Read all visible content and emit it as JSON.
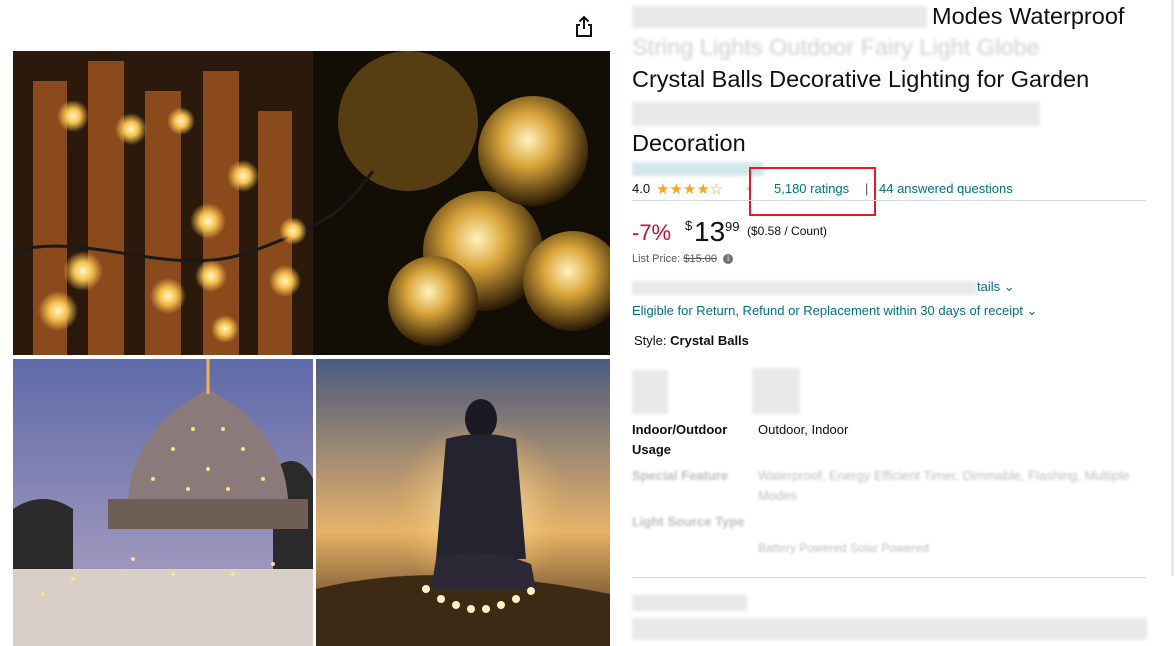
{
  "product": {
    "title_line1": "Modes Waterproof",
    "title_line2": "String Lights Outdoor Fairy Light Globe",
    "title_line3": "Crystal Balls Decorative Lighting for Garden",
    "title_line4": "Decoration"
  },
  "rating": {
    "value": "4.0",
    "stars": "★★★★☆",
    "caret": "⌄",
    "count_label": "5,180 ratings",
    "separator": "|",
    "answered_label": "44 answered questions"
  },
  "price": {
    "discount": "-7%",
    "currency": "$",
    "whole": "13",
    "fraction": "99",
    "unit_price": "($0.58 / Count)",
    "list_label": "List Price:",
    "list_value": "$15.00",
    "info_icon": "i"
  },
  "delivery": {
    "tail": "tails ⌄"
  },
  "returns": {
    "label": "Eligible for Return, Refund or Replacement within 30 days of receipt ⌄"
  },
  "style": {
    "label": "Style:",
    "value": "Crystal Balls"
  },
  "specs": {
    "usage_label": "Indoor/Outdoor Usage",
    "usage_value": "Outdoor, Indoor",
    "feature_label": "Special Feature",
    "feature_value": "Waterproof, Energy Efficient Timer, Dimmable, Flashing, Multiple Modes",
    "source_label": "Light Source Type",
    "source_value": "Battery Powered Solar Powered"
  },
  "icons": {
    "share": "share-icon",
    "star": "star-icon",
    "info": "info-icon"
  },
  "colors": {
    "link": "#007185",
    "discount": "#CC0C39",
    "star": "#FFA41C",
    "highlight": "#e31b23"
  }
}
